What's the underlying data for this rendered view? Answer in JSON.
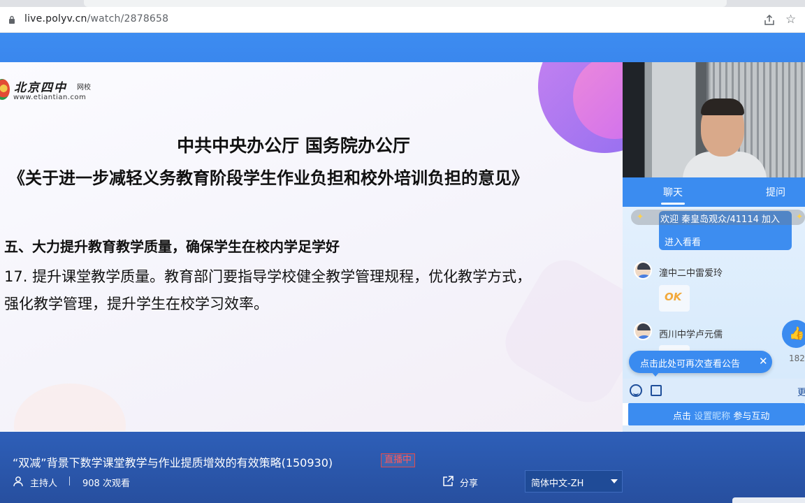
{
  "browser": {
    "url_host": "live.polyv.cn",
    "url_path": "/watch/2878658"
  },
  "slide": {
    "logo_name": "北京四中",
    "logo_tag": "网校",
    "logo_site": "www.etiantian.com",
    "heading_1": "中共中央办公厅 国务院办公厅",
    "heading_2": "《关于进一步减轻义务教育阶段学生作业负担和校外培训负担的意见》",
    "section_title": "五、大力提升教育教学质量，确保学生在校内学足学好",
    "body_line_1": "17. 提升课堂教学质量。教育部门要指导学校健全教学管理规程，优化教学方式，",
    "body_line_2": "强化教学管理，提升学生在校学习效率。"
  },
  "side_panel": {
    "tab_chat": "聊天",
    "tab_question": "提问",
    "welcome_text": "欢迎  秦皇岛观众/41114  加入",
    "bubble_tail": "进入看看",
    "chat_messages": [
      {
        "user": "潼中二中雷爱玲",
        "content": "OK"
      },
      {
        "user": "西川中学卢元儒",
        "content": ""
      }
    ],
    "notice_text": "点击此处可再次查看公告",
    "like_count": "182",
    "more_label": "更",
    "interact_prefix": "点击",
    "interact_link": "设置昵称",
    "interact_suffix": "参与互动"
  },
  "info_bar": {
    "title": "“双减”背景下数学课堂教学与作业提质增效的有效策略(150930)",
    "live_badge": "直播中",
    "host_label": "主持人",
    "views": "908 次观看",
    "share_label": "分享",
    "language": "简体中文-ZH"
  },
  "colors": {
    "accent_blue": "#3b8cf0",
    "info_bar_blue": "#2e5fb8",
    "live_red": "#e44b4b"
  }
}
